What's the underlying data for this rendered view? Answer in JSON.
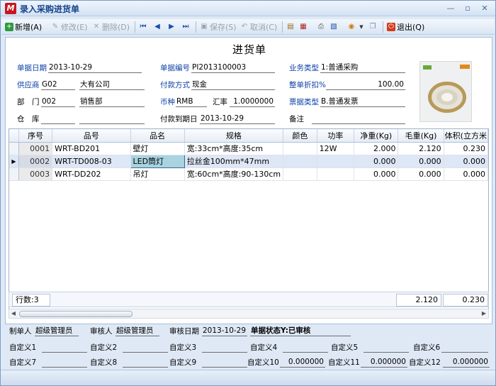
{
  "window": {
    "title": "录入采购进货单"
  },
  "toolbar": {
    "new": "新增(A)",
    "edit": "修改(E)",
    "delete": "删除(D)",
    "save": "保存(S)",
    "cancel": "取消(C)",
    "exit": "退出(Q)"
  },
  "doc": {
    "title": "进货单",
    "date_label": "单据日期",
    "date_value": "2013-10-29",
    "no_label": "单据编号",
    "no_value": "PI2013100003",
    "biztype_label": "业务类型",
    "biztype_value": "1:普通采购",
    "supplier_label": "供应商",
    "supplier_code": "G02",
    "supplier_name": "大有公司",
    "payment_label": "付款方式",
    "payment_value": "现金",
    "discount_label": "整单折扣%",
    "discount_value": "100.00",
    "dept_label": "部　门",
    "dept_code": "002",
    "dept_name": "销售部",
    "currency_label": "币种",
    "currency_value": "RMB",
    "rate_label": "汇率",
    "rate_value": "1.0000000",
    "invoice_label": "票据类型",
    "invoice_value": "B.普通发票",
    "warehouse_label": "仓　库",
    "warehouse_value": "",
    "duedate_label": "付款到期日",
    "duedate_value": "2013-10-29",
    "remark_label": "备注",
    "remark_value": ""
  },
  "grid": {
    "headers": [
      "序号",
      "品号",
      "品名",
      "规格",
      "颜色",
      "功率",
      "净重(Kg)",
      "毛重(Kg)",
      "体积(立方米"
    ],
    "rows": [
      [
        "0001",
        "WRT-BD201",
        "壁灯",
        "宽:33cm*高度:35cm",
        "",
        "12W",
        "2.000",
        "2.120",
        "0.230"
      ],
      [
        "0002",
        "WRT-TD008-03",
        "LED筒灯",
        "拉丝金100mm*47mm",
        "",
        "",
        "0.000",
        "0.000",
        "0.000"
      ],
      [
        "0003",
        "WRT-DD202",
        "吊灯",
        "宽:60cm*高度:90-130cm",
        "",
        "",
        "0.000",
        "0.000",
        "0.000"
      ]
    ],
    "row_count": "行数:3",
    "sum_gross": "2.120",
    "sum_volume": "0.230"
  },
  "footer": {
    "maker_label": "制单人",
    "maker_value": "超级管理员",
    "auditor_label": "审核人",
    "auditor_value": "超级管理员",
    "auditdate_label": "审核日期",
    "auditdate_value": "2013-10-29",
    "status_label": "单据状态Y:已审核",
    "c1": "自定义1",
    "c2": "自定义2",
    "c3": "自定义3",
    "c4": "自定义4",
    "c5": "自定义5",
    "c6": "自定义6",
    "c7": "自定义7",
    "c8": "自定义8",
    "c9": "自定义9",
    "c10": "自定义10",
    "c10_value": "0.000000",
    "c11": "自定义11",
    "c11_value": "0.000000",
    "c12": "自定义12",
    "c12_value": "0.000000"
  },
  "colors": {
    "title_blue": "#15428b",
    "label_blue": "#0a3ea6",
    "selected_cell": "#a9d3e0"
  }
}
